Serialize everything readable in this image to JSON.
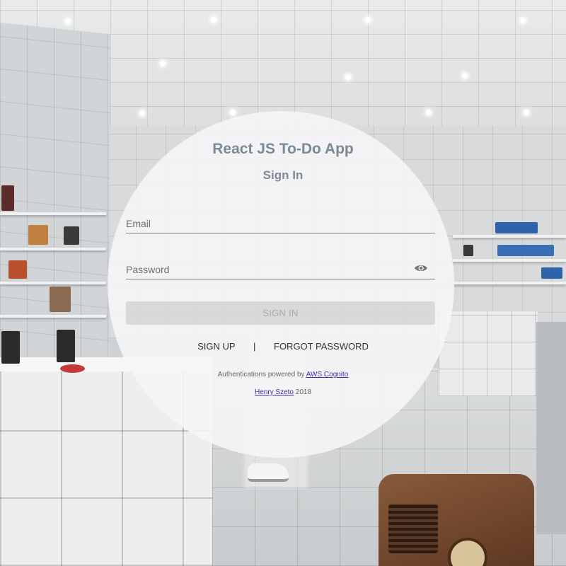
{
  "app": {
    "title": "React JS To-Do App",
    "subtitle": "Sign In"
  },
  "form": {
    "email_placeholder": "Email",
    "email_value": "",
    "password_placeholder": "Password",
    "password_value": "",
    "show_password_icon": "eye-icon",
    "signin_label": "SIGN IN"
  },
  "links": {
    "signup_label": "SIGN UP",
    "separator": "|",
    "forgot_label": "FORGOT PASSWORD"
  },
  "footer": {
    "powered_text": "Authentications powered by",
    "powered_link": "AWS Cognito",
    "author_link": "Henry Szeto",
    "year": "2018"
  },
  "colors": {
    "title": "#7a8a96",
    "link": "#4b2aa8",
    "button_disabled": "#d2d4d6"
  }
}
